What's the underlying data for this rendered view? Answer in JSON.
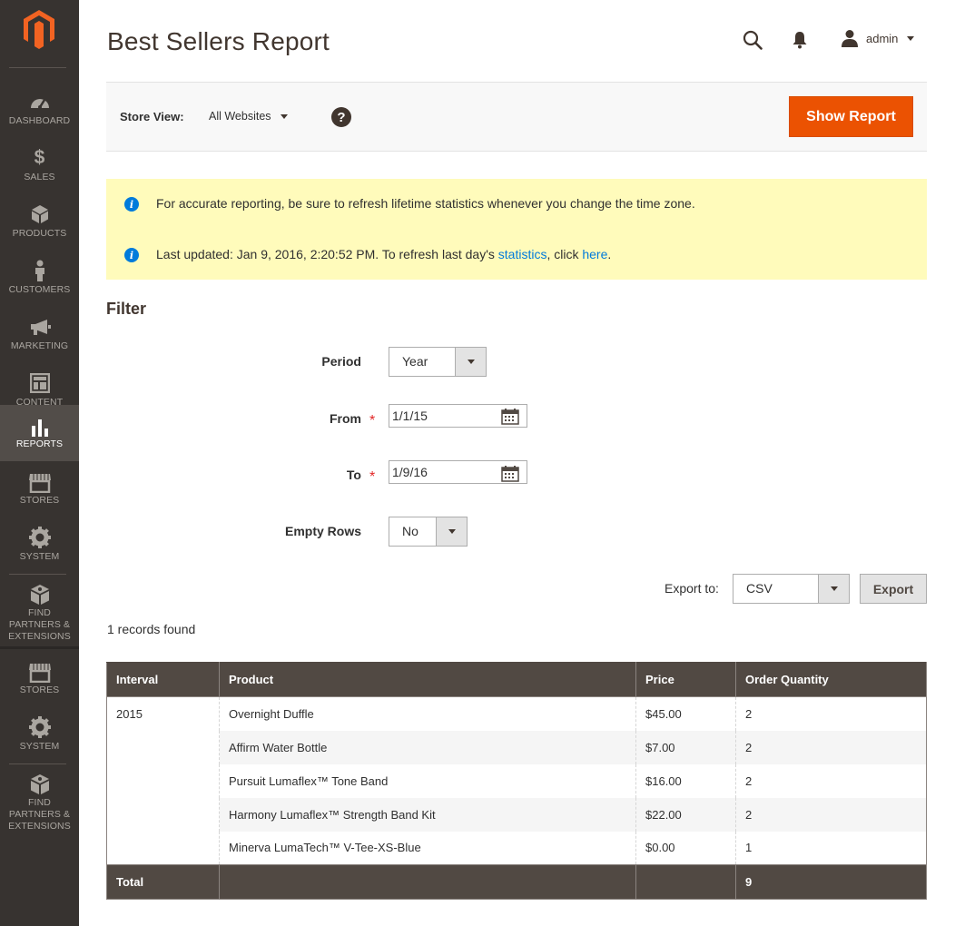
{
  "sidebar": {
    "items": [
      {
        "label": "DASHBOARD",
        "icon": "dashboard-icon"
      },
      {
        "label": "SALES",
        "icon": "dollar-icon"
      },
      {
        "label": "PRODUCTS",
        "icon": "cube-icon"
      },
      {
        "label": "CUSTOMERS",
        "icon": "person-icon"
      },
      {
        "label": "MARKETING",
        "icon": "megaphone-icon"
      },
      {
        "label": "CONTENT",
        "icon": "layout-icon"
      },
      {
        "label": "REPORTS",
        "icon": "bar-chart-icon",
        "active": true
      },
      {
        "label": "STORES",
        "icon": "storefront-icon"
      },
      {
        "label": "SYSTEM",
        "icon": "gear-icon"
      },
      {
        "label": "FIND PARTNERS & EXTENSIONS",
        "icon": "extensions-icon"
      },
      {
        "label": "STORES",
        "icon": "storefront-icon"
      },
      {
        "label": "SYSTEM",
        "icon": "gear-icon"
      },
      {
        "label": "FIND PARTNERS & EXTENSIONS",
        "icon": "extensions-icon"
      }
    ]
  },
  "header": {
    "title": "Best Sellers Report",
    "user": "admin"
  },
  "store_bar": {
    "label": "Store View:",
    "selected": "All Websites",
    "help": "?",
    "show_report": "Show Report"
  },
  "messages": {
    "timezone": "For accurate reporting, be sure to refresh lifetime statistics whenever you change the time zone.",
    "updated_prefix": "Last updated: Jan 9, 2016, 2:20:52 PM. To refresh last day's ",
    "statistics_link": "statistics",
    "middle": ", click ",
    "here_link": "here",
    "suffix": "."
  },
  "filter": {
    "title": "Filter",
    "period_label": "Period",
    "period_value": "Year",
    "from_label": "From",
    "from_value": "1/1/15",
    "to_label": "To",
    "to_value": "1/9/16",
    "empty_rows_label": "Empty Rows",
    "empty_rows_value": "No",
    "required_mark": "*"
  },
  "export": {
    "label": "Export to:",
    "format": "CSV",
    "button": "Export"
  },
  "records_found": "1 records found",
  "table": {
    "columns": [
      "Interval",
      "Product",
      "Price",
      "Order Quantity"
    ],
    "interval": "2015",
    "rows": [
      {
        "product": "Overnight Duffle",
        "price": "$45.00",
        "qty": "2"
      },
      {
        "product": "Affirm Water Bottle",
        "price": "$7.00",
        "qty": "2"
      },
      {
        "product": "Pursuit Lumaflex™ Tone Band",
        "price": "$16.00",
        "qty": "2"
      },
      {
        "product": "Harmony Lumaflex™ Strength Band Kit",
        "price": "$22.00",
        "qty": "2"
      },
      {
        "product": "Minerva LumaTech™ V-Tee-XS-Blue",
        "price": "$0.00",
        "qty": "1"
      }
    ],
    "total_label": "Total",
    "total_qty": "9"
  },
  "colors": {
    "sidebar": "#373330",
    "accent": "#eb5202",
    "link": "#007bdb",
    "notice": "#fffbbb",
    "table_header": "#514943"
  }
}
